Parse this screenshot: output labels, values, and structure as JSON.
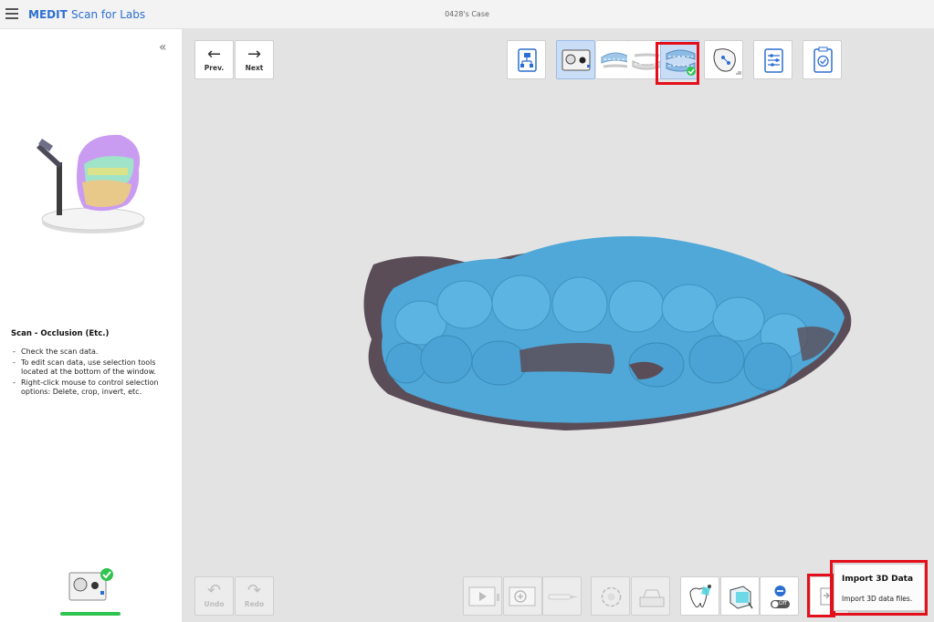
{
  "app": {
    "brand": "MEDIT",
    "brand_sub": "Scan for Labs",
    "case_title": "0428's Case"
  },
  "sidebar": {
    "collapse_glyph": "«",
    "step_title": "Scan - Occlusion (Etc.)",
    "instructions": [
      "Check the scan data.",
      "To edit scan data, use selection tools located at the bottom of the window.",
      "Right-click mouse to control selection options: Delete, crop, invert, etc."
    ],
    "stage_status_color": "#2fc34f"
  },
  "nav": {
    "prev_label": "Prev.",
    "next_label": "Next",
    "prev_icon": "arrow-left-icon",
    "next_icon": "arrow-right-icon"
  },
  "top_toolbar": {
    "icons": [
      "workflow-icon",
      "scanner-stage-icon",
      "upper-jaw-icon",
      "lower-jaw-icon",
      "occlusion-icon",
      "scan-strategy-icon",
      "settings-icon",
      "complete-icon"
    ],
    "active": "scanner-stage-icon",
    "highlighted": "occlusion-icon"
  },
  "bottom_toolbar": {
    "undo_label": "Undo",
    "redo_label": "Redo",
    "icons": [
      "play-icon",
      "add-scan-icon",
      "brush-icon",
      "rotate-icon",
      "scanner-tray-icon",
      "tooth-selection-icon",
      "box-selection-icon",
      "toggle-off-icon",
      "import-icon"
    ],
    "toggle_text": "Off"
  },
  "tooltip": {
    "title": "Import 3D Data",
    "description": "Import 3D data files."
  },
  "colors": {
    "brand": "#2d6fd1",
    "model_blue": "#4fa8d8",
    "model_shadow": "#5b4d58",
    "highlight": "#e3101c",
    "viewport": "#e3e3e3"
  }
}
